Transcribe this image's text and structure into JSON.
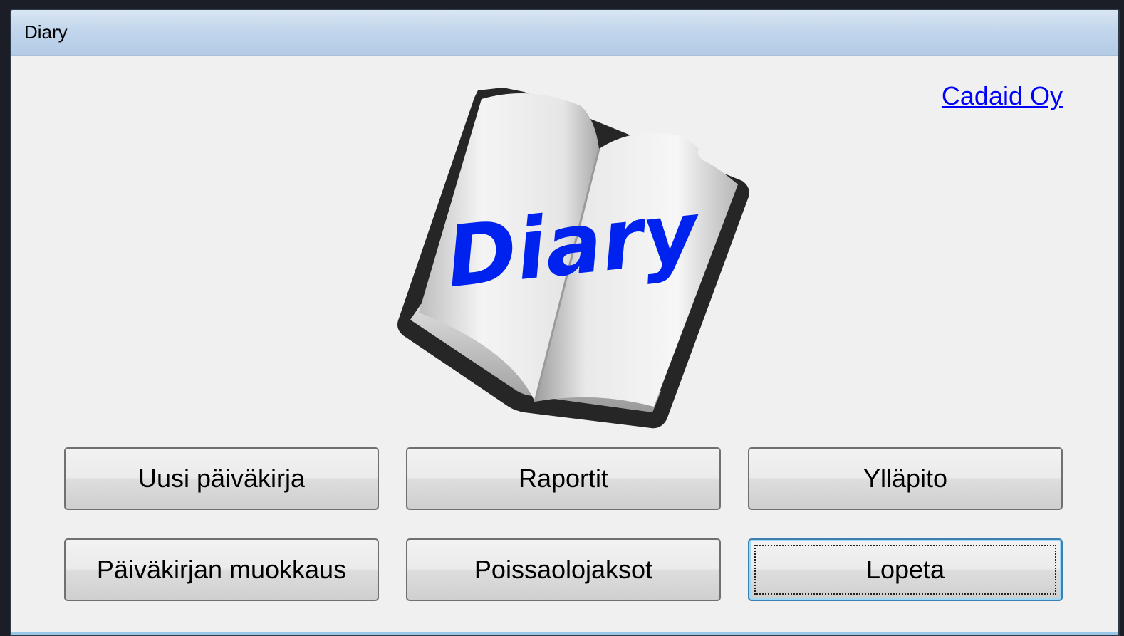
{
  "window": {
    "title": "Diary"
  },
  "header": {
    "company_link": "Cadaid Oy"
  },
  "logo": {
    "text": "Diary",
    "text_color": "#0022ee",
    "icon": "open-book-icon"
  },
  "buttons": {
    "new_diary": "Uusi päiväkirja",
    "reports": "Raportit",
    "maintenance": "Ylläpito",
    "edit_diary": "Päiväkirjan muokkaus",
    "absence_periods": "Poissaolojaksot",
    "quit": "Lopeta"
  },
  "focused_button": "quit"
}
